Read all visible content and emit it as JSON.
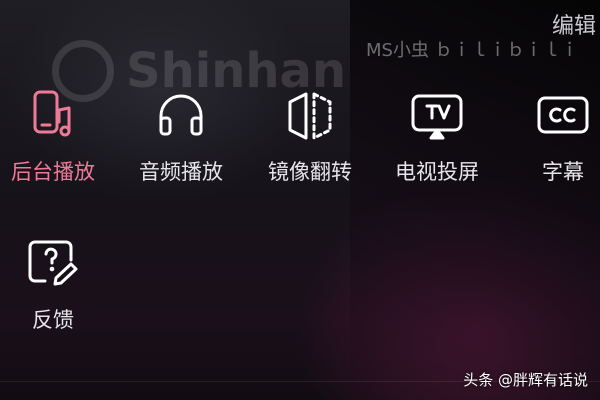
{
  "header": {
    "edit_label": "编辑"
  },
  "background": {
    "watermark_text": "Shinhan",
    "overlay_text": "MS小虫 ｂｉｌｉｂｉｌｉ"
  },
  "menu": {
    "items": [
      {
        "label": "后台播放",
        "icon": "phone-music-icon",
        "active": true
      },
      {
        "label": "音频播放",
        "icon": "headphones-icon",
        "active": false
      },
      {
        "label": "镜像翻转",
        "icon": "mirror-flip-icon",
        "active": false
      },
      {
        "label": "电视投屏",
        "icon": "tv-cast-icon",
        "active": false
      },
      {
        "label": "字幕",
        "icon": "subtitles-cc-icon",
        "active": false
      },
      {
        "label": "反馈",
        "icon": "feedback-icon",
        "active": false
      }
    ]
  },
  "footer": {
    "credit": "头条 @胖辉有话说"
  },
  "colors": {
    "accent": "#ee7a98",
    "text": "#e6e6ea",
    "icon": "#ffffff"
  }
}
